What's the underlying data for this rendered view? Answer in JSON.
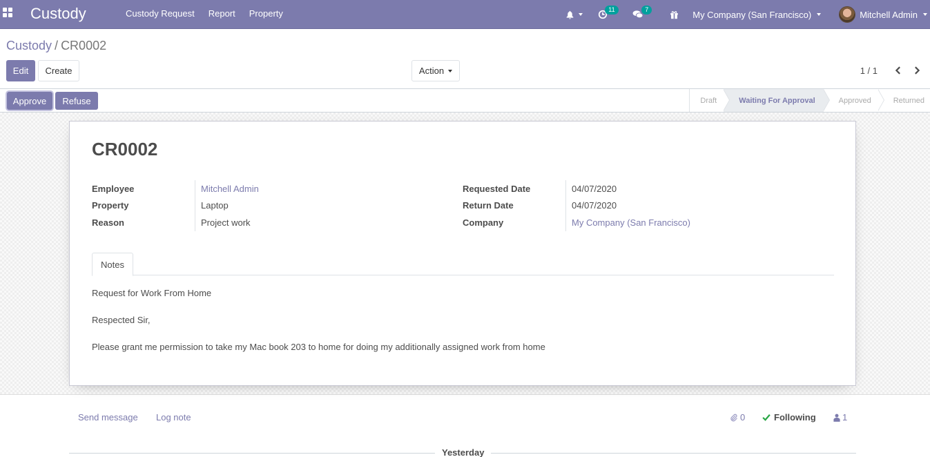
{
  "navbar": {
    "brand": "Custody",
    "menu": [
      "Custody Request",
      "Report",
      "Property"
    ],
    "activity_count": "11",
    "messages_count": "7",
    "company": "My Company (San Francisco)",
    "user": "Mitchell Admin"
  },
  "control_panel": {
    "breadcrumb_parent": "Custody",
    "breadcrumb_separator": "/",
    "breadcrumb_current": "CR0002",
    "edit_label": "Edit",
    "create_label": "Create",
    "action_label": "Action",
    "pager": "1 / 1"
  },
  "statusbar": {
    "approve_label": "Approve",
    "refuse_label": "Refuse",
    "stages": [
      "Draft",
      "Waiting For Approval",
      "Approved",
      "Returned"
    ],
    "active_stage": "Waiting For Approval"
  },
  "form": {
    "title": "CR0002",
    "left_fields": [
      {
        "label": "Employee",
        "value": "Mitchell Admin"
      },
      {
        "label": "Property",
        "value": "Laptop"
      },
      {
        "label": "Reason",
        "value": "Project work"
      }
    ],
    "right_fields": [
      {
        "label": "Requested Date",
        "value": "04/07/2020"
      },
      {
        "label": "Return Date",
        "value": "04/07/2020"
      },
      {
        "label": "Company",
        "value": "My Company (San Francisco)"
      }
    ],
    "tab_label": "Notes",
    "notes": [
      "Request for Work From Home",
      "Respected Sir,",
      "Please grant me permission to take my Mac book 203 to home for doing my additionally assigned work from home"
    ]
  },
  "chatter": {
    "send_message": "Send message",
    "log_note": "Log note",
    "attachments": "0",
    "following": "Following",
    "followers": "1",
    "date_separator": "Yesterday"
  },
  "colors": {
    "brand": "#7c7bad",
    "badge": "#00a09d",
    "following_check": "#28a745"
  }
}
